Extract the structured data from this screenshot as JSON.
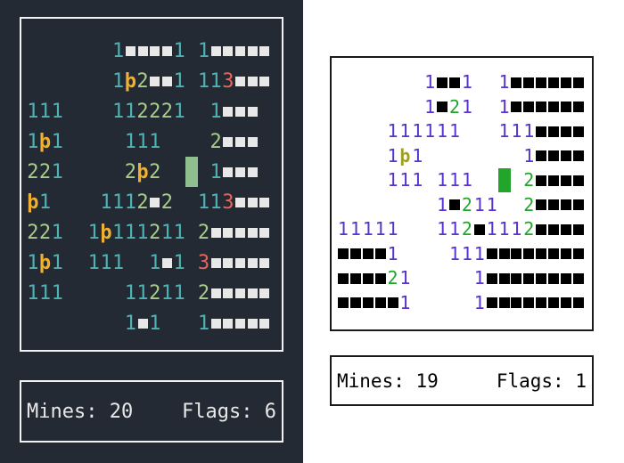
{
  "colors": {
    "dark_bg": "#232a33",
    "dark_one": "#4fb3b3",
    "dark_two": "#a9cc8b",
    "dark_three": "#e8655e",
    "dark_flag": "#f0b030",
    "dark_hidden": "#e8e8e8",
    "dark_cursor": "#8fbf8f",
    "light_one": "#5533cc",
    "light_two": "#22a52a",
    "light_flag": "#a0a020",
    "light_hidden": "#000000",
    "light_cursor": "#22a52a"
  },
  "games": [
    {
      "id": "dark",
      "status": {
        "mines_label": "Mines: 20",
        "flags_label": "Flags: 6"
      },
      "rows": [
        "       1####1 1#####",
        "       1F2##1 113###",
        "111    112221  1###",
        "1F1     111    2###",
        "221     2F2  C 1###",
        "F1    1112#2  113###",
        "221  1F111211 2#####",
        "1F1  111  1#1 3#####",
        "111     11211 2#####",
        "        1#1   1#####"
      ]
    },
    {
      "id": "light",
      "status": {
        "mines_label": "Mines: 19",
        "flags_label": "Flags: 1"
      },
      "rows": [
        "       1##1  1######",
        "       1#21  1######",
        "    111111   111####",
        "    1F1        1####",
        "    111 111  C 2####",
        "        1#211  2####",
        "11111   112#1112####",
        "####1    111########",
        "####21     1########",
        "#####1     1########"
      ]
    }
  ]
}
